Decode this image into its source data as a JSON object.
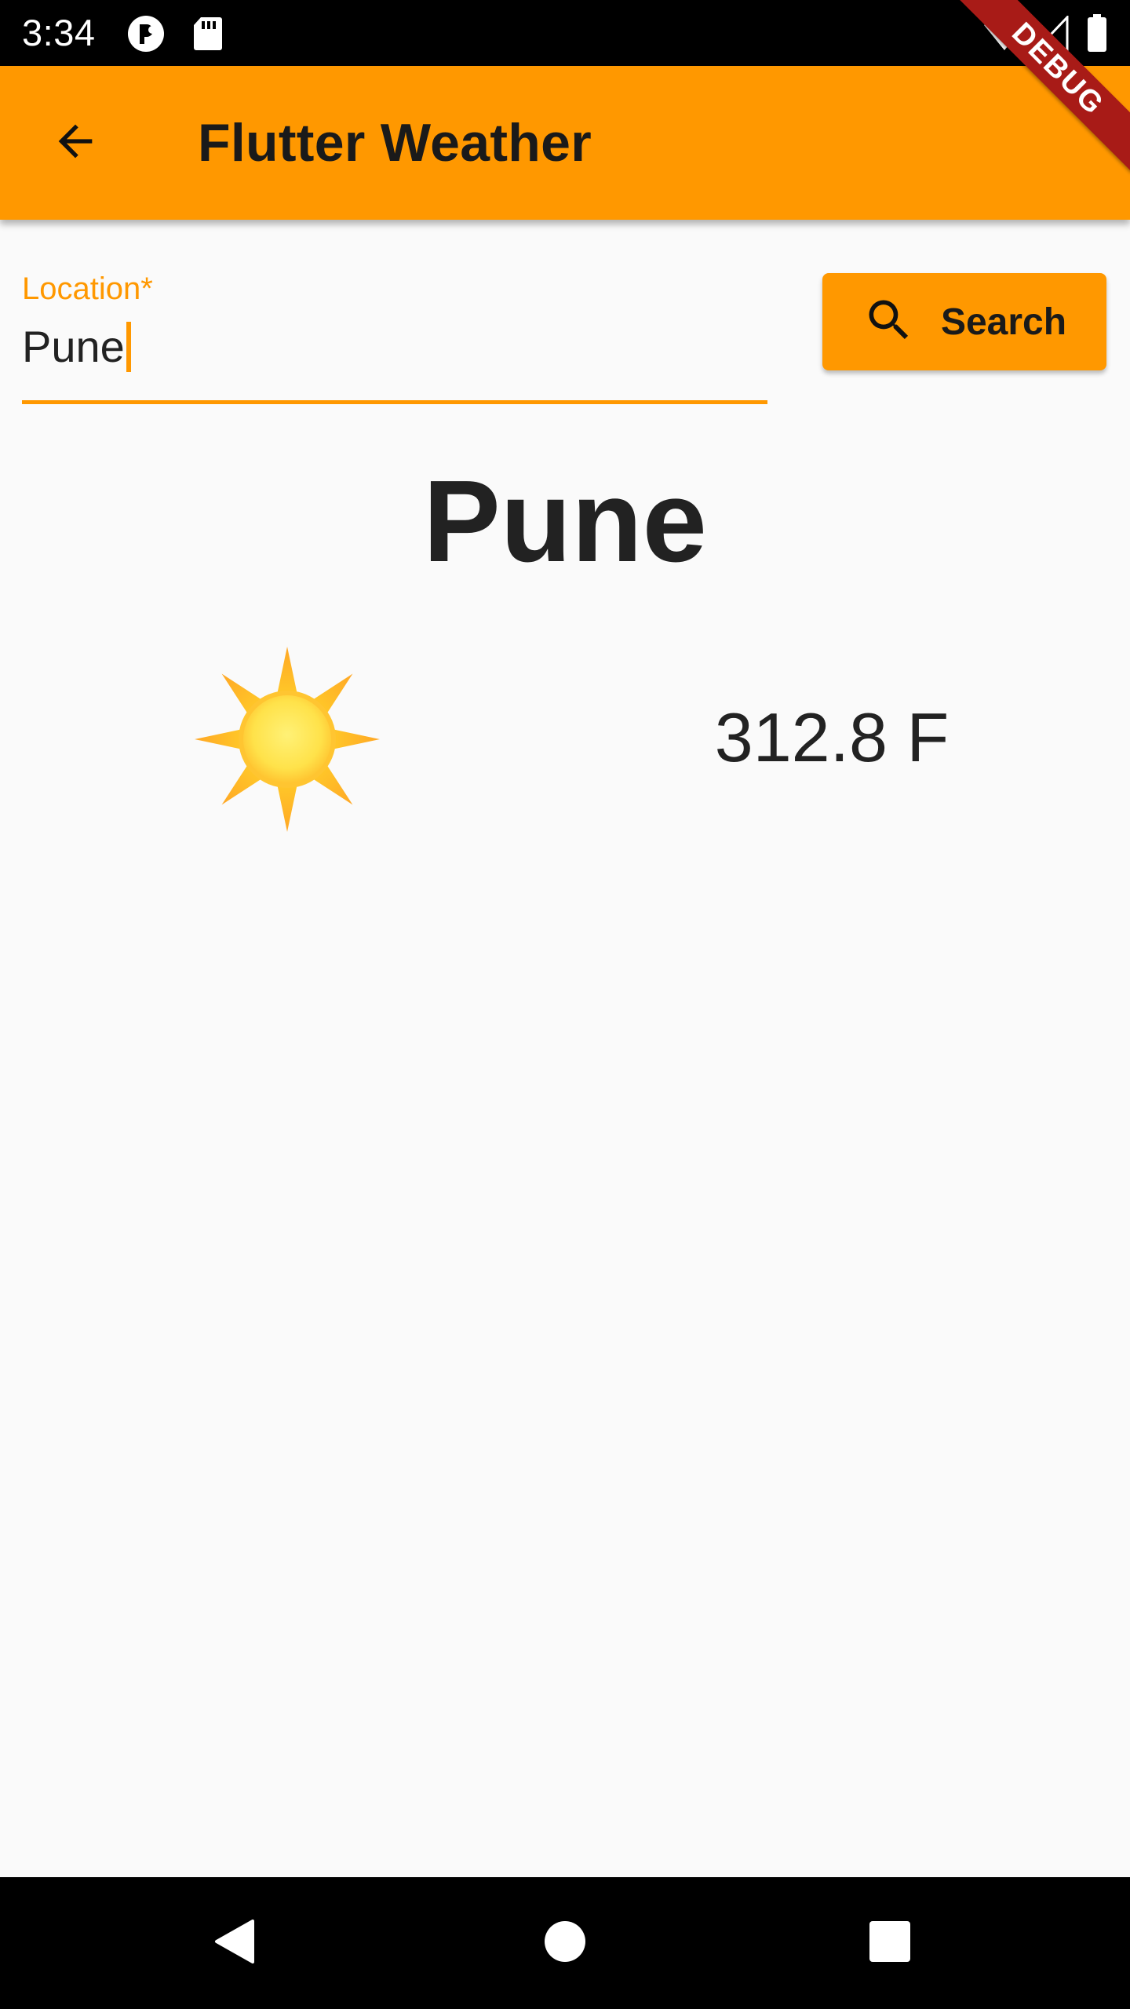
{
  "status_bar": {
    "time": "3:34",
    "icons": [
      "notification-app-icon",
      "sd-card-icon",
      "wifi-icon",
      "cellular-signal-icon",
      "battery-icon"
    ]
  },
  "debug_banner": {
    "label": "DEBUG"
  },
  "app_bar": {
    "title": "Flutter Weather",
    "back_icon": "arrow-back-icon",
    "background_color": "#ff9800"
  },
  "search_form": {
    "location_label": "Location*",
    "location_value": "Pune",
    "search_button_label": "Search",
    "search_icon": "search-icon",
    "accent_color": "#ff9800"
  },
  "weather": {
    "city": "Pune",
    "condition_icon": "sun-icon",
    "temperature": "312.8 F"
  },
  "nav_bar": {
    "buttons": [
      "back-triangle-icon",
      "home-circle-icon",
      "recents-square-icon"
    ]
  }
}
